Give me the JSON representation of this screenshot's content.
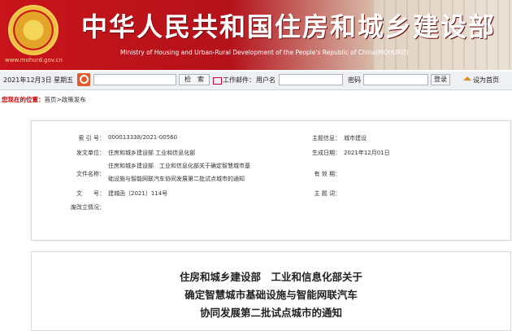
{
  "header": {
    "site_url": "www.mohurd.gov.cn",
    "title_cn": "中华人民共和国住房和城乡建设部",
    "title_en": "Ministry of Housing and Urban-Rural Development of the People's Republic of China(MOHURD)",
    "icons": [
      "national-emblem-icon"
    ]
  },
  "searchbar": {
    "date": "2021年12月3日 星期五",
    "search_button": "检　索",
    "mail_label": "工作邮件：",
    "user_label": "用户名",
    "password_label": "密码",
    "login_button": "登录",
    "set_homepage": "设为首页",
    "icons": [
      "search-icon",
      "mail-icon",
      "home-icon"
    ]
  },
  "breadcrumb": {
    "label": "您现在的位置：",
    "path": "首页>政策发布"
  },
  "info": {
    "index_label": "索 引 号：",
    "index_value": "000013338/2021-00560",
    "issuer_label": "发文单位：",
    "issuer_value": "住房和城乡建设部 工业和信息化部",
    "docname_label": "文件名称：",
    "docname_line1": "住房和城乡建设部　工业和信息化部关于确定智慧城市基",
    "docname_line2": "础设施与智能网联汽车协同发展第二批试点城市的通知",
    "docno_label": "文　　号：",
    "docno_value": "建城函〔2021〕114号",
    "abolish_label": "废改立情况：",
    "subject_label": "主题信息：",
    "subject_value": "城市建设",
    "date_label": "生成日期：",
    "date_value": "2021年12月01日",
    "validity_label": "有 效 期：",
    "keywords_label": "主 题 词："
  },
  "article": {
    "title_line1": "住房和城乡建设部　工业和信息化部关于",
    "title_line2": "确定智慧城市基础设施与智能网联汽车",
    "title_line3": "协同发展第二批试点城市的通知"
  }
}
